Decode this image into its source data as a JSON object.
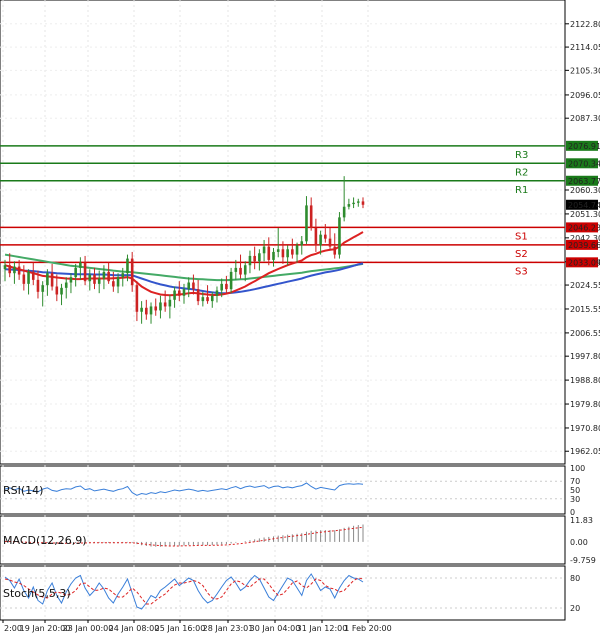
{
  "colors": {
    "up": "#2e8b2e",
    "down": "#cc2222",
    "resistance": "#1a7a1a",
    "support": "#cc0000",
    "ma_fast": "#dd2222",
    "ma_mid": "#3355cc",
    "ma_slow": "#44aa66",
    "rsi": "#3a7fd9",
    "macd_signal": "#dd2222",
    "macd_hist": "#888888",
    "stoch_k": "#3a7fd9",
    "stoch_d": "#dd2222"
  },
  "chart_data": [
    {
      "type": "candlestick",
      "panel": "price",
      "ylim": [
        1958,
        2131
      ],
      "y_ticks": [
        "2122.80",
        "2114.05",
        "2105.30",
        "2096.05",
        "2087.30",
        "2060.30",
        "2051.30",
        "2042.30",
        "2033.30",
        "2024.55",
        "2015.55",
        "2006.55",
        "1997.80",
        "1988.80",
        "1979.80",
        "1970.80",
        "1962.05"
      ],
      "x_ticks": [
        "2:00",
        "19 Jan 20:00",
        "23 Jan 00:00",
        "24 Jan 08:00",
        "25 Jan 16:00",
        "28 Jan 23:01",
        "30 Jan 04:00",
        "31 Jan 12:00",
        "1 Feb 20:00"
      ],
      "levels": [
        {
          "name": "R3",
          "value": 2076.91,
          "label": "2076.91",
          "kind": "resistance"
        },
        {
          "name": "R2",
          "value": 2070.34,
          "label": "2070.34",
          "kind": "resistance"
        },
        {
          "name": "R1",
          "value": 2063.77,
          "label": "2063.77",
          "kind": "resistance"
        },
        {
          "name": "S1",
          "value": 2046.23,
          "label": "2046.23",
          "kind": "support"
        },
        {
          "name": "S2",
          "value": 2039.66,
          "label": "2039.66",
          "kind": "support"
        },
        {
          "name": "S3",
          "value": 2033.09,
          "label": "2033.09",
          "kind": "support"
        }
      ],
      "last_price": {
        "value": 2054.74,
        "label": "2054.74"
      },
      "candles": [
        [
          2030.5,
          2034.0,
          2026.0,
          2032.0
        ],
        [
          2032.0,
          2036.5,
          2027.5,
          2029.0
        ],
        [
          2029.0,
          2033.5,
          2025.0,
          2031.5
        ],
        [
          2031.5,
          2034.0,
          2026.5,
          2028.5
        ],
        [
          2028.5,
          2032.0,
          2022.5,
          2025.0
        ],
        [
          2025.0,
          2030.5,
          2021.0,
          2029.5
        ],
        [
          2029.5,
          2033.0,
          2024.5,
          2026.5
        ],
        [
          2026.5,
          2030.0,
          2019.5,
          2022.0
        ],
        [
          2022.0,
          2026.0,
          2016.5,
          2024.5
        ],
        [
          2024.5,
          2030.5,
          2020.5,
          2029.0
        ],
        [
          2029.0,
          2032.5,
          2022.5,
          2024.0
        ],
        [
          2024.0,
          2028.5,
          2018.5,
          2021.0
        ],
        [
          2021.0,
          2025.0,
          2017.0,
          2023.5
        ],
        [
          2023.5,
          2027.5,
          2019.5,
          2025.5
        ],
        [
          2025.5,
          2029.0,
          2021.5,
          2027.5
        ],
        [
          2027.5,
          2032.5,
          2024.0,
          2031.0
        ],
        [
          2031.0,
          2035.0,
          2026.5,
          2033.0
        ],
        [
          2033.0,
          2035.5,
          2024.5,
          2026.0
        ],
        [
          2026.0,
          2030.5,
          2022.5,
          2028.5
        ],
        [
          2028.5,
          2031.0,
          2023.0,
          2025.0
        ],
        [
          2025.0,
          2030.0,
          2021.5,
          2027.0
        ],
        [
          2027.0,
          2032.0,
          2023.0,
          2029.5
        ],
        [
          2029.5,
          2033.0,
          2025.0,
          2026.0
        ],
        [
          2026.0,
          2029.5,
          2022.0,
          2024.0
        ],
        [
          2024.0,
          2029.0,
          2021.5,
          2027.5
        ],
        [
          2027.5,
          2031.0,
          2024.0,
          2029.0
        ],
        [
          2029.0,
          2036.0,
          2026.0,
          2034.5
        ],
        [
          2034.5,
          2037.0,
          2022.0,
          2024.5
        ],
        [
          2024.5,
          2026.0,
          2011.0,
          2014.5
        ],
        [
          2014.5,
          2018.5,
          2010.0,
          2016.0
        ],
        [
          2016.0,
          2019.0,
          2011.5,
          2013.5
        ],
        [
          2013.5,
          2018.0,
          2010.0,
          2016.5
        ],
        [
          2016.5,
          2019.5,
          2013.0,
          2015.0
        ],
        [
          2015.0,
          2020.5,
          2012.0,
          2018.0
        ],
        [
          2018.0,
          2022.5,
          2014.5,
          2016.5
        ],
        [
          2016.5,
          2021.0,
          2012.0,
          2019.0
        ],
        [
          2019.0,
          2024.0,
          2016.0,
          2022.5
        ],
        [
          2022.5,
          2026.0,
          2018.5,
          2020.5
        ],
        [
          2020.5,
          2025.0,
          2017.5,
          2023.0
        ],
        [
          2023.0,
          2027.5,
          2020.0,
          2025.5
        ],
        [
          2025.5,
          2028.5,
          2021.0,
          2023.0
        ],
        [
          2023.0,
          2026.5,
          2017.0,
          2018.5
        ],
        [
          2018.5,
          2022.0,
          2016.5,
          2020.0
        ],
        [
          2020.0,
          2024.5,
          2017.5,
          2018.5
        ],
        [
          2018.5,
          2022.0,
          2016.0,
          2020.5
        ],
        [
          2020.5,
          2024.0,
          2018.0,
          2022.5
        ],
        [
          2022.5,
          2027.0,
          2020.0,
          2025.0
        ],
        [
          2025.0,
          2028.0,
          2021.5,
          2023.0
        ],
        [
          2023.0,
          2031.0,
          2021.5,
          2029.5
        ],
        [
          2029.5,
          2034.0,
          2026.5,
          2031.0
        ],
        [
          2031.0,
          2036.0,
          2027.0,
          2028.5
        ],
        [
          2028.5,
          2033.5,
          2026.0,
          2032.0
        ],
        [
          2032.0,
          2037.5,
          2029.0,
          2035.5
        ],
        [
          2035.5,
          2039.0,
          2030.5,
          2033.5
        ],
        [
          2033.5,
          2038.0,
          2030.0,
          2036.5
        ],
        [
          2036.5,
          2041.5,
          2033.5,
          2039.0
        ],
        [
          2039.0,
          2042.5,
          2032.0,
          2034.0
        ],
        [
          2034.0,
          2038.5,
          2031.5,
          2037.0
        ],
        [
          2037.0,
          2046.0,
          2035.0,
          2038.0
        ],
        [
          2038.0,
          2041.0,
          2032.5,
          2035.0
        ],
        [
          2035.0,
          2039.5,
          2032.0,
          2038.0
        ],
        [
          2038.0,
          2042.0,
          2034.5,
          2036.0
        ],
        [
          2036.0,
          2040.5,
          2033.0,
          2039.5
        ],
        [
          2039.5,
          2043.0,
          2036.0,
          2041.0
        ],
        [
          2041.0,
          2058.0,
          2040.0,
          2054.5
        ],
        [
          2054.5,
          2057.5,
          2045.0,
          2046.0
        ],
        [
          2046.0,
          2049.5,
          2037.0,
          2039.5
        ],
        [
          2039.5,
          2045.0,
          2036.0,
          2043.5
        ],
        [
          2043.5,
          2047.5,
          2040.5,
          2042.0
        ],
        [
          2042.0,
          2046.0,
          2037.5,
          2039.0
        ],
        [
          2039.0,
          2044.0,
          2034.5,
          2036.0
        ],
        [
          2036.0,
          2052.0,
          2034.5,
          2050.0
        ],
        [
          2050.0,
          2065.5,
          2048.5,
          2054.0
        ],
        [
          2054.0,
          2057.0,
          2053.0,
          2055.0
        ],
        [
          2055.0,
          2057.5,
          2053.5,
          2055.5
        ],
        [
          2055.5,
          2057.0,
          2054.0,
          2056.0
        ],
        [
          2056.0,
          2057.5,
          2053.5,
          2054.74
        ]
      ],
      "ma_fast": [
        2032.0,
        2031.5,
        2031.0,
        2030.5,
        2030.0,
        2029.5,
        2029.0,
        2028.5,
        2028.0,
        2027.8,
        2027.6,
        2027.4,
        2027.2,
        2027.0,
        2026.9,
        2026.8,
        2026.8,
        2026.9,
        2027.0,
        2027.0,
        2027.0,
        2027.0,
        2027.0,
        2027.1,
        2027.2,
        2027.3,
        2027.5,
        2027.0,
        2025.5,
        2024.0,
        2023.0,
        2022.0,
        2021.5,
        2021.0,
        2020.8,
        2020.7,
        2020.8,
        2021.0,
        2021.2,
        2021.5,
        2021.6,
        2021.4,
        2021.2,
        2021.0,
        2020.8,
        2020.8,
        2021.0,
        2021.3,
        2021.8,
        2022.5,
        2023.2,
        2024.0,
        2025.0,
        2026.0,
        2027.0,
        2028.0,
        2029.0,
        2029.8,
        2030.6,
        2031.3,
        2032.0,
        2032.6,
        2033.2,
        2033.8,
        2035.0,
        2035.8,
        2036.3,
        2037.0,
        2037.5,
        2037.8,
        2038.0,
        2039.0,
        2040.5,
        2041.5,
        2042.5,
        2043.5,
        2044.5
      ],
      "ma_mid": [
        2030.5,
        2030.4,
        2030.3,
        2030.2,
        2030.0,
        2029.9,
        2029.8,
        2029.6,
        2029.4,
        2029.3,
        2029.2,
        2029.0,
        2028.9,
        2028.8,
        2028.7,
        2028.6,
        2028.6,
        2028.6,
        2028.6,
        2028.5,
        2028.5,
        2028.5,
        2028.4,
        2028.3,
        2028.2,
        2028.2,
        2028.3,
        2028.2,
        2027.6,
        2027.0,
        2026.4,
        2025.8,
        2025.3,
        2024.8,
        2024.4,
        2024.0,
        2023.7,
        2023.5,
        2023.3,
        2023.1,
        2022.9,
        2022.6,
        2022.3,
        2022.0,
        2021.8,
        2021.6,
        2021.5,
        2021.5,
        2021.6,
        2021.8,
        2022.0,
        2022.3,
        2022.6,
        2023.0,
        2023.4,
        2023.8,
        2024.2,
        2024.6,
        2025.0,
        2025.4,
        2025.8,
        2026.2,
        2026.6,
        2027.0,
        2027.6,
        2028.1,
        2028.5,
        2028.9,
        2029.3,
        2029.6,
        2029.9,
        2030.3,
        2030.8,
        2031.3,
        2031.8,
        2032.3,
        2032.7
      ],
      "ma_slow": [
        2036.0,
        2035.7,
        2035.4,
        2035.1,
        2034.8,
        2034.5,
        2034.2,
        2033.9,
        2033.6,
        2033.3,
        2033.0,
        2032.7,
        2032.4,
        2032.1,
        2031.8,
        2031.6,
        2031.4,
        2031.2,
        2031.0,
        2030.8,
        2030.6,
        2030.4,
        2030.2,
        2030.0,
        2029.8,
        2029.6,
        2029.5,
        2029.4,
        2029.2,
        2029.0,
        2028.8,
        2028.6,
        2028.4,
        2028.2,
        2028.0,
        2027.8,
        2027.6,
        2027.4,
        2027.2,
        2027.0,
        2026.9,
        2026.8,
        2026.7,
        2026.6,
        2026.5,
        2026.4,
        2026.4,
        2026.4,
        2026.5,
        2026.6,
        2026.7,
        2026.8,
        2027.0,
        2027.2,
        2027.4,
        2027.6,
        2027.8,
        2028.0,
        2028.2,
        2028.4,
        2028.6,
        2028.8,
        2029.0,
        2029.2,
        2029.5,
        2029.8,
        2030.0,
        2030.2,
        2030.4,
        2030.6,
        2030.8,
        2031.0,
        2031.3,
        2031.6,
        2031.9,
        2032.2,
        2032.5
      ]
    },
    {
      "type": "line",
      "panel": "rsi",
      "title": "RSI(14)",
      "ylim": [
        0,
        100
      ],
      "y_ticks": [
        "100",
        "70",
        "50",
        "30",
        "0"
      ],
      "values": [
        52,
        55,
        50,
        54,
        47,
        50,
        48,
        46,
        52,
        55,
        49,
        47,
        51,
        53,
        52,
        57,
        59,
        51,
        53,
        48,
        50,
        52,
        49,
        47,
        51,
        53,
        58,
        44,
        38,
        42,
        40,
        44,
        42,
        46,
        44,
        47,
        50,
        48,
        50,
        52,
        50,
        47,
        49,
        47,
        49,
        51,
        53,
        51,
        55,
        58,
        53,
        57,
        59,
        56,
        58,
        60,
        54,
        58,
        59,
        55,
        57,
        55,
        58,
        60,
        66,
        58,
        52,
        56,
        54,
        52,
        50,
        60,
        63,
        64,
        63,
        64,
        63
      ]
    },
    {
      "type": "bar",
      "panel": "macd",
      "title": "MACD(12,26,9)",
      "ylim": [
        -9.759,
        11.83
      ],
      "y_ticks": [
        "11.83",
        "0.00",
        "-9.759"
      ],
      "histogram": [
        0.2,
        0.1,
        0.0,
        -0.1,
        -0.2,
        -0.3,
        -0.4,
        -0.5,
        -0.6,
        -0.6,
        -0.7,
        -0.8,
        -0.8,
        -0.8,
        -0.7,
        -0.6,
        -0.5,
        -0.4,
        -0.4,
        -0.4,
        -0.4,
        -0.4,
        -0.5,
        -0.5,
        -0.5,
        -0.5,
        -0.3,
        -0.5,
        -1.2,
        -1.8,
        -2.2,
        -2.5,
        -2.6,
        -2.6,
        -2.5,
        -2.4,
        -2.2,
        -2.0,
        -1.9,
        -1.7,
        -1.6,
        -1.7,
        -1.8,
        -1.8,
        -1.7,
        -1.6,
        -1.4,
        -1.2,
        -0.8,
        -0.4,
        0.0,
        0.4,
        0.9,
        1.4,
        1.9,
        2.4,
        2.7,
        3.0,
        3.4,
        3.6,
        3.9,
        4.1,
        4.4,
        4.7,
        5.5,
        6.0,
        6.1,
        6.3,
        6.4,
        6.4,
        6.3,
        6.8,
        7.6,
        8.2,
        8.7,
        9.1,
        9.4
      ],
      "signal": [
        0.3,
        0.2,
        0.1,
        0.0,
        -0.1,
        -0.2,
        -0.3,
        -0.4,
        -0.4,
        -0.5,
        -0.6,
        -0.6,
        -0.7,
        -0.7,
        -0.7,
        -0.7,
        -0.6,
        -0.6,
        -0.5,
        -0.5,
        -0.5,
        -0.5,
        -0.5,
        -0.5,
        -0.5,
        -0.5,
        -0.5,
        -0.5,
        -0.7,
        -1.0,
        -1.3,
        -1.6,
        -1.8,
        -2.0,
        -2.1,
        -2.2,
        -2.2,
        -2.2,
        -2.1,
        -2.1,
        -2.0,
        -1.9,
        -1.9,
        -1.9,
        -1.8,
        -1.8,
        -1.7,
        -1.6,
        -1.4,
        -1.2,
        -0.9,
        -0.6,
        -0.3,
        0.1,
        0.5,
        0.9,
        1.3,
        1.7,
        2.1,
        2.4,
        2.8,
        3.1,
        3.4,
        3.7,
        4.1,
        4.5,
        4.9,
        5.2,
        5.5,
        5.8,
        6.0,
        6.3,
        6.6,
        7.0,
        7.3,
        7.6,
        7.9
      ]
    },
    {
      "type": "line",
      "panel": "stoch",
      "title": "Stoch(5,5,3)",
      "ylim": [
        0,
        100
      ],
      "y_ticks": [
        "80",
        "20"
      ],
      "k": [
        82,
        75,
        60,
        78,
        55,
        40,
        62,
        35,
        28,
        55,
        70,
        45,
        30,
        52,
        68,
        80,
        85,
        60,
        45,
        55,
        70,
        58,
        40,
        30,
        48,
        62,
        78,
        50,
        22,
        18,
        30,
        45,
        40,
        55,
        62,
        70,
        78,
        65,
        72,
        80,
        75,
        55,
        40,
        30,
        35,
        48,
        62,
        75,
        82,
        70,
        55,
        62,
        75,
        85,
        78,
        60,
        42,
        35,
        50,
        65,
        80,
        75,
        60,
        45,
        75,
        88,
        72,
        55,
        62,
        58,
        40,
        60,
        75,
        85,
        80,
        78,
        72
      ],
      "d": [
        78,
        76,
        72,
        70,
        65,
        58,
        52,
        46,
        42,
        40,
        48,
        52,
        50,
        45,
        48,
        55,
        68,
        70,
        62,
        55,
        56,
        60,
        58,
        50,
        42,
        42,
        50,
        60,
        52,
        40,
        28,
        28,
        35,
        42,
        48,
        58,
        66,
        70,
        70,
        72,
        75,
        72,
        65,
        50,
        40,
        38,
        42,
        55,
        68,
        75,
        72,
        65,
        62,
        70,
        78,
        78,
        68,
        55,
        45,
        48,
        58,
        70,
        74,
        65,
        60,
        68,
        78,
        75,
        65,
        60,
        58,
        52,
        55,
        65,
        75,
        80,
        78
      ]
    }
  ]
}
